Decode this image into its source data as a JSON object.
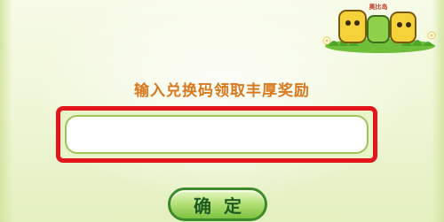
{
  "logo": {
    "icon": "game-logo-icon",
    "text": "奥比岛"
  },
  "redeem": {
    "prompt": "输入兑换码领取丰厚奖励",
    "input_value": "",
    "input_placeholder": "",
    "confirm_label": "确定"
  },
  "colors": {
    "prompt": "#d9781c",
    "highlight_border": "#e3161e",
    "button_green": "#7cc13f"
  }
}
